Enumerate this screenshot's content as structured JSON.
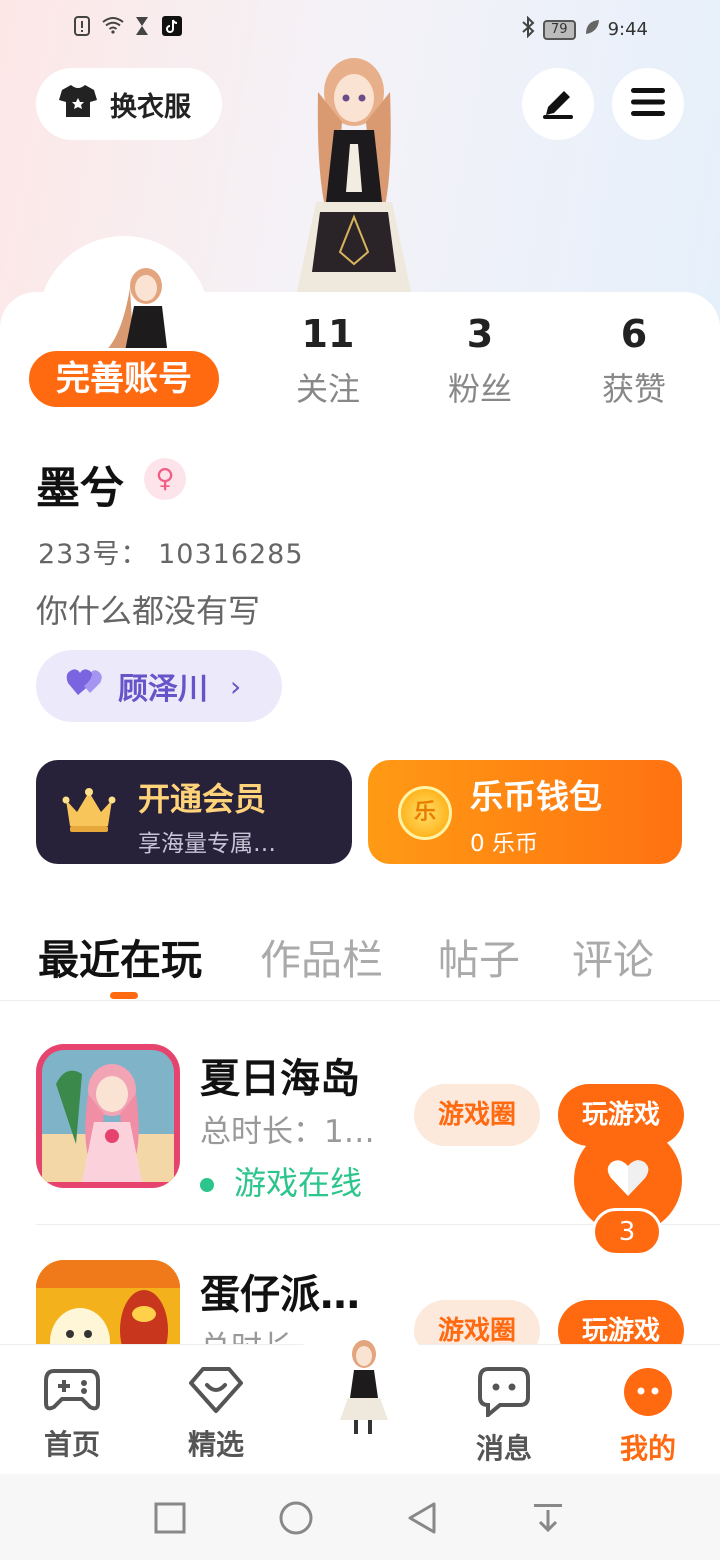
{
  "status_bar": {
    "time": "9:44",
    "battery": "79",
    "left_icons": [
      "alert-icon",
      "wifi-icon",
      "hourglass-icon",
      "tiktok-icon"
    ],
    "right_icons": [
      "bluetooth-icon",
      "battery-icon",
      "leaf-icon"
    ]
  },
  "header": {
    "outfit_label": "换衣服",
    "edit_icon": "pen-icon",
    "menu_icon": "menu-icon"
  },
  "profile": {
    "complete_account_label": "完善账号",
    "stats": [
      {
        "value": "11",
        "label": "关注"
      },
      {
        "value": "3",
        "label": "粉丝"
      },
      {
        "value": "6",
        "label": "获赞"
      }
    ],
    "username": "墨兮",
    "gender_symbol": "♀",
    "uid": "233号： 10316285",
    "bio": "你什么都没有写",
    "partner_name": "顾泽川",
    "partner_chevron": "›"
  },
  "cards": {
    "vip_title": "开通会员",
    "vip_sub": "享海量专属…",
    "wallet_title": "乐币钱包",
    "wallet_coin_glyph": "乐",
    "wallet_sub": "0 乐币"
  },
  "tabs": [
    "最近在玩",
    "作品栏",
    "帖子",
    "评论"
  ],
  "active_tab": "最近在玩",
  "games": [
    {
      "name": "夏日海岛",
      "time": "总时长：1…",
      "status": "游戏在线",
      "circle_label": "游戏圈",
      "play_label": "玩游戏"
    },
    {
      "name": "蛋仔派…",
      "time": "总时长…",
      "status": "",
      "circle_label": "游戏圈",
      "play_label": "玩游戏"
    }
  ],
  "like_fab": {
    "count": "3"
  },
  "bottom_nav": [
    {
      "label": "首页",
      "icon": "gamepad-icon"
    },
    {
      "label": "精选",
      "icon": "heart-box-icon"
    },
    {
      "label": "消息",
      "icon": "chat-icon"
    },
    {
      "label": "我的",
      "icon": "face-icon"
    }
  ],
  "colors": {
    "accent": "#ff6a10",
    "online": "#2cc58c",
    "partner": "#6654c8",
    "vip_bg": "#27223a"
  }
}
